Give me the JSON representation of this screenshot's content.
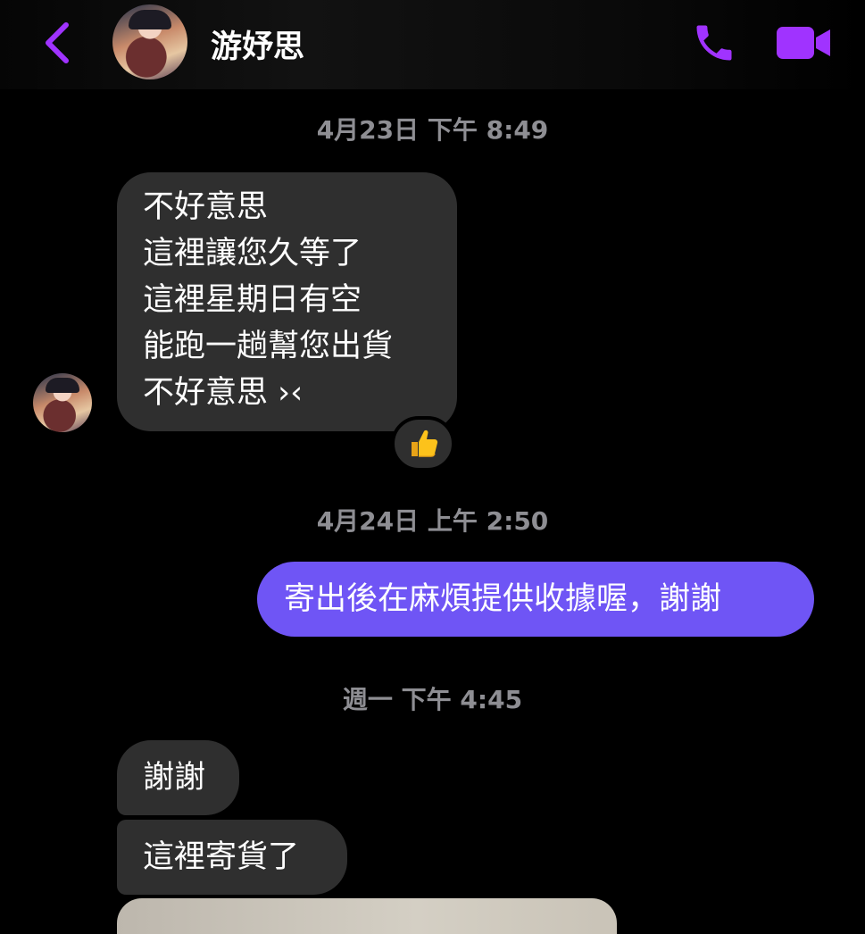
{
  "header": {
    "contact_name": "游妤思",
    "accent_color": "#a033ff",
    "icons": [
      "back-chevron-icon",
      "phone-icon",
      "video-camera-icon"
    ]
  },
  "messages": {
    "timestamp_1": "4月23日 下午 8:49",
    "incoming_1_lines": [
      "不好意思",
      "這裡讓您久等了",
      "這裡星期日有空",
      "能跑一趟幫您出貨",
      "不好意思 ›‹"
    ],
    "reaction_1": "thumbs-up",
    "timestamp_2": "4月24日 上午 2:50",
    "outgoing_1": "寄出後在麻煩提供收據喔，謝謝",
    "timestamp_3": "週一 下午 4:45",
    "incoming_2": "謝謝",
    "incoming_3": "這裡寄貨了"
  },
  "colors": {
    "incoming_bubble": "#2f2f2f",
    "outgoing_bubble": "#6f55f5",
    "timestamp": "#8e8e93"
  }
}
